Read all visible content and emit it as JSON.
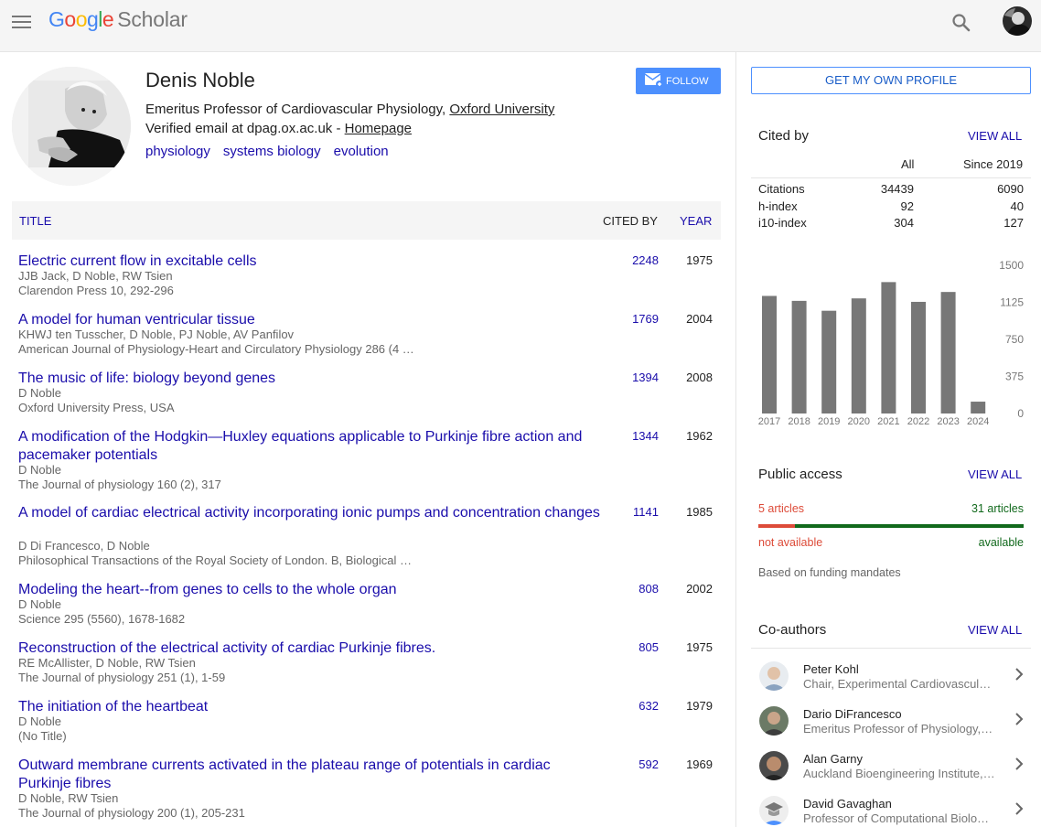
{
  "header": {
    "logo_google": "Google",
    "logo_scholar": "Scholar"
  },
  "profile": {
    "name": "Denis Noble",
    "affiliation_prefix": "Emeritus Professor of Cardiovascular Physiology,",
    "affiliation_link": "Oxford University",
    "email_text": "Verified email at dpag.ox.ac.uk -",
    "homepage": "Homepage",
    "interests": [
      "physiology",
      "systems biology",
      "evolution"
    ],
    "follow_label": "FOLLOW"
  },
  "table": {
    "col_title": "TITLE",
    "col_cited": "CITED BY",
    "col_year": "YEAR",
    "rows": [
      {
        "title": "Electric current flow in excitable cells",
        "authors": "JJB Jack, D Noble, RW Tsien",
        "venue": "Clarendon Press 10, 292-296",
        "cited": "2248",
        "year": "1975"
      },
      {
        "title": "A model for human ventricular tissue",
        "authors": "KHWJ ten Tusscher, D Noble, PJ Noble, AV Panfilov",
        "venue": "American Journal of Physiology-Heart and Circulatory Physiology 286 (4 …",
        "cited": "1769",
        "year": "2004"
      },
      {
        "title": "The music of life: biology beyond genes",
        "authors": "D Noble",
        "venue": "Oxford University Press, USA",
        "cited": "1394",
        "year": "2008"
      },
      {
        "title": "A modification of the Hodgkin—Huxley equations applicable to Purkinje fibre action and pacemaker potentials",
        "authors": "D Noble",
        "venue": "The Journal of physiology 160 (2), 317",
        "cited": "1344",
        "year": "1962"
      },
      {
        "title": "A model of cardiac electrical activity incorporating ionic pumps and concentration changes",
        "authors": "D Di Francesco, D Noble",
        "venue": "Philosophical Transactions of the Royal Society of London. B, Biological …",
        "cited": "1141",
        "year": "1985"
      },
      {
        "title": "Modeling the heart--from genes to cells to the whole organ",
        "authors": "D Noble",
        "venue": "Science 295 (5560), 1678-1682",
        "cited": "808",
        "year": "2002"
      },
      {
        "title": "Reconstruction of the electrical activity of cardiac Purkinje fibres.",
        "authors": "RE McAllister, D Noble, RW Tsien",
        "venue": "The Journal of physiology 251 (1), 1-59",
        "cited": "805",
        "year": "1975"
      },
      {
        "title": "The initiation of the heartbeat",
        "authors": "D Noble",
        "venue": "(No Title)",
        "cited": "632",
        "year": "1979"
      },
      {
        "title": "Outward membrane currents activated in the plateau range of potentials in cardiac Purkinje fibres",
        "authors": "D Noble, RW Tsien",
        "venue": "The Journal of physiology 200 (1), 205-231",
        "cited": "592",
        "year": "1969"
      }
    ]
  },
  "sidebar": {
    "own_profile_label": "GET MY OWN PROFILE",
    "cited_by": {
      "title": "Cited by",
      "view_all": "VIEW ALL",
      "col_all": "All",
      "col_since": "Since 2019",
      "stats": [
        {
          "label": "Citations",
          "all": "34439",
          "since": "6090"
        },
        {
          "label": "h-index",
          "all": "92",
          "since": "40"
        },
        {
          "label": "i10-index",
          "all": "304",
          "since": "127"
        }
      ]
    },
    "public_access": {
      "title": "Public access",
      "view_all": "VIEW ALL",
      "not_available_count": "5 articles",
      "available_count": "31 articles",
      "not_available_label": "not available",
      "available_label": "available",
      "available_fraction": 0.861,
      "note": "Based on funding mandates",
      "color_not_available": "#dd4b39",
      "color_available": "#11691c"
    },
    "coauthors": {
      "title": "Co-authors",
      "view_all": "VIEW ALL",
      "items": [
        {
          "name": "Peter Kohl",
          "affiliation": "Chair, Experimental Cardiovascular Medicine"
        },
        {
          "name": "Dario DiFrancesco",
          "affiliation": "Emeritus Professor of Physiology, University of Milano"
        },
        {
          "name": "Alan Garny",
          "affiliation": "Auckland Bioengineering Institute, University of Auckland"
        },
        {
          "name": "David Gavaghan",
          "affiliation": "Professor of Computational Biology, University of Oxford"
        }
      ]
    }
  },
  "chart_data": {
    "type": "bar",
    "categories": [
      "2017",
      "2018",
      "2019",
      "2020",
      "2021",
      "2022",
      "2023",
      "2024"
    ],
    "values": [
      1190,
      1140,
      1040,
      1165,
      1330,
      1130,
      1230,
      120
    ],
    "yticks": [
      "1500",
      "1125",
      "750",
      "375",
      "0"
    ],
    "ylim": [
      0,
      1500
    ],
    "bar_color": "#777777"
  }
}
